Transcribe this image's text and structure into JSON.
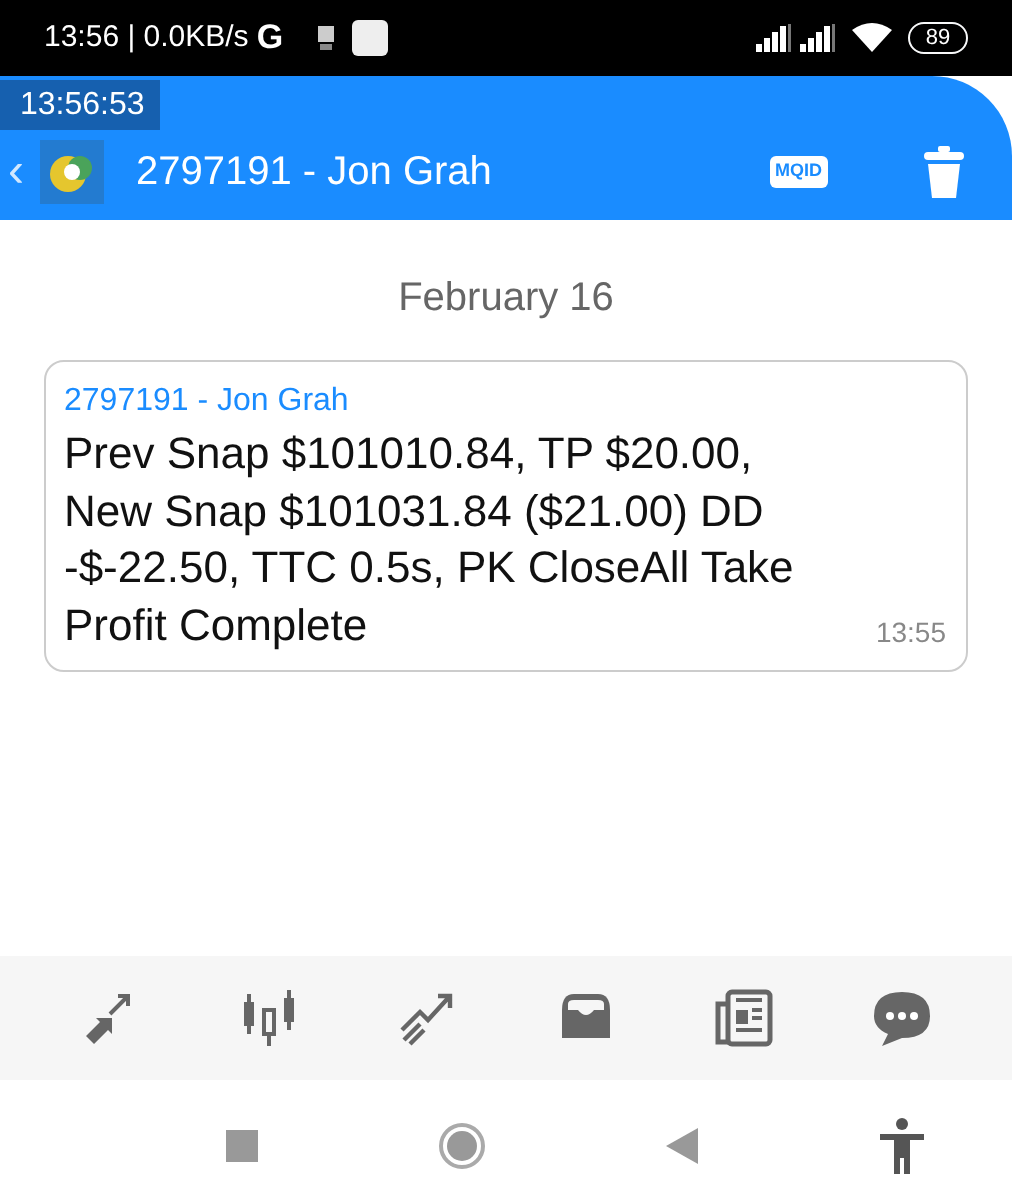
{
  "status_bar": {
    "time_speed": "13:56 | 0.0KB/s",
    "g": "G",
    "battery": "89"
  },
  "overlay_time": "13:56:53",
  "app_bar": {
    "back": "‹",
    "title": "2797191 - Jon Grah",
    "badge": "MQID"
  },
  "date": "February 16",
  "messages": [
    {
      "sender": "2797191 - Jon Grah",
      "text": "Prev Snap $101010.84, TP $20.00, New Snap $101031.84 ($21.00) DD -$-22.50, TTC 0.5s, PK CloseAll Take Profit Complete",
      "time": "13:55"
    }
  ],
  "toolbar": [
    {
      "kind": "trade"
    },
    {
      "kind": "chart"
    },
    {
      "kind": "signals"
    },
    {
      "kind": "inbox"
    },
    {
      "kind": "news"
    },
    {
      "kind": "chat"
    }
  ]
}
